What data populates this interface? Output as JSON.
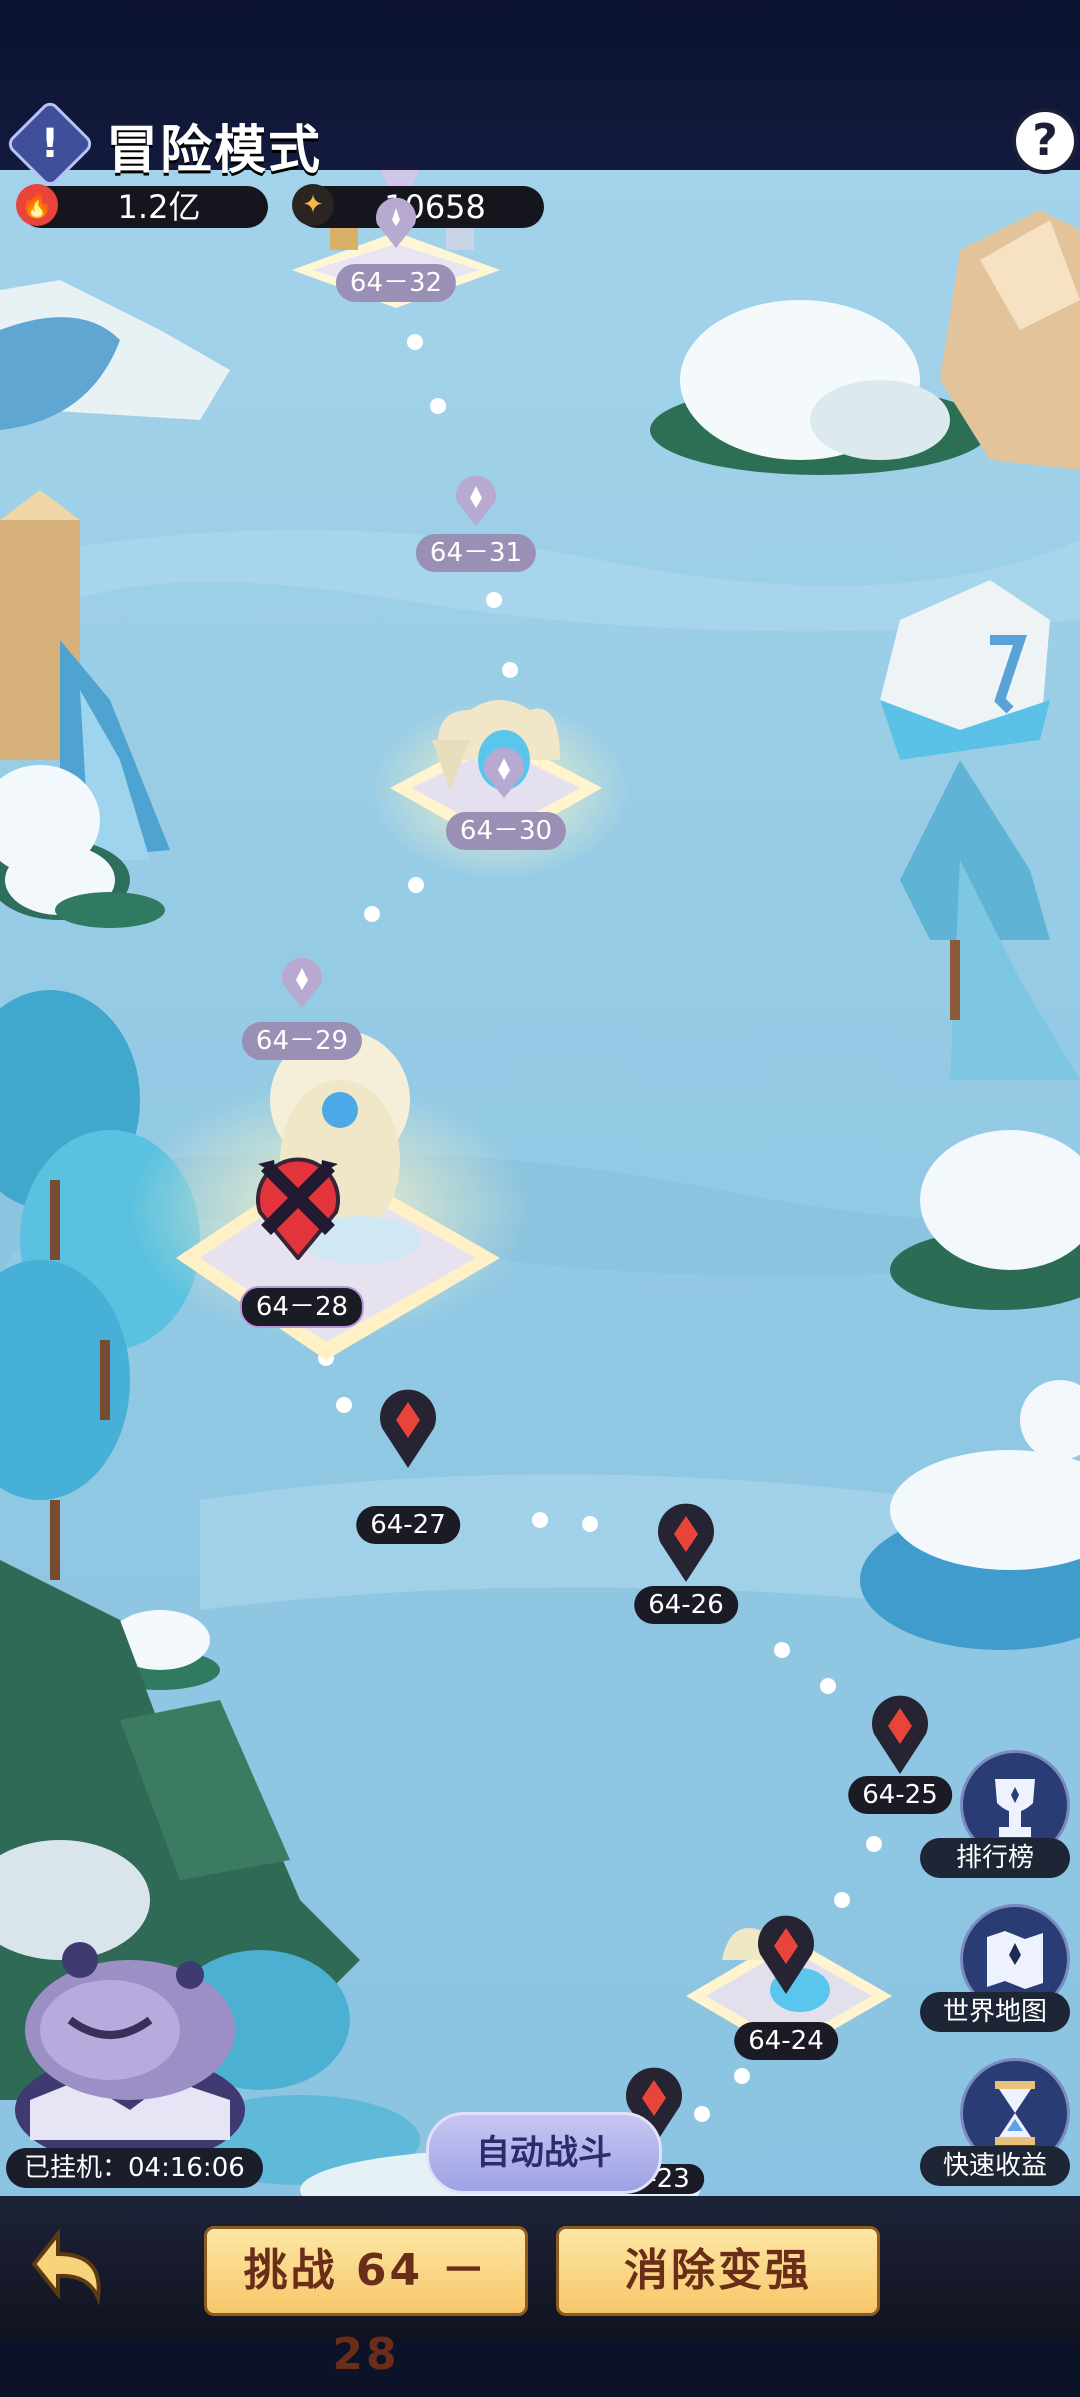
{
  "header": {
    "title": "冒险模式",
    "info_icon": "!",
    "help_icon": "?"
  },
  "resources": [
    {
      "icon": "flame-icon",
      "value": "1.2亿"
    },
    {
      "icon": "star-crystal-icon",
      "value": "10658"
    }
  ],
  "stages": [
    {
      "id": "64-32",
      "label": "64－32",
      "state": "locked"
    },
    {
      "id": "64-31",
      "label": "64－31",
      "state": "locked"
    },
    {
      "id": "64-30",
      "label": "64－30",
      "state": "locked"
    },
    {
      "id": "64-29",
      "label": "64－29",
      "state": "locked"
    },
    {
      "id": "64-28",
      "label": "64－28",
      "state": "current"
    },
    {
      "id": "64-27",
      "label": "64-27",
      "state": "cleared"
    },
    {
      "id": "64-26",
      "label": "64-26",
      "state": "cleared"
    },
    {
      "id": "64-25",
      "label": "64-25",
      "state": "cleared"
    },
    {
      "id": "64-24",
      "label": "64-24",
      "state": "cleared"
    },
    {
      "id": "64-23",
      "label": "64-23",
      "state": "cleared"
    }
  ],
  "side_buttons": {
    "ranking": {
      "label": "排行榜",
      "icon": "trophy-icon"
    },
    "world_map": {
      "label": "世界地图",
      "icon": "map-icon"
    },
    "quick_income": {
      "label": "快速收益",
      "icon": "hourglass-icon"
    }
  },
  "auto_battle": "自动战斗",
  "afk_status": "已挂机：04:16:06",
  "bottom": {
    "challenge": "挑战 64 － 28",
    "upgrade": "消除变强"
  },
  "colors": {
    "sky": "#9fd0e8",
    "snow": "#f2f8fb",
    "pine": "#2f6b52",
    "pin_red": "#e8443a",
    "pin_dark": "#262433",
    "pin_locked": "#b7a9d0",
    "button_gold": "#f6c76a"
  }
}
